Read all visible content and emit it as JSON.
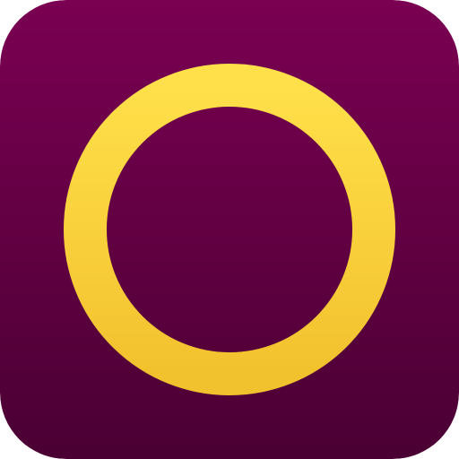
{
  "app_icon": {
    "name": "ring-app-icon",
    "icon": "ring-icon",
    "colors": {
      "background_top": "#7A0052",
      "background_bottom": "#4A0033",
      "ring_top": "#FFE04A",
      "ring_bottom": "#F2C12E"
    }
  }
}
